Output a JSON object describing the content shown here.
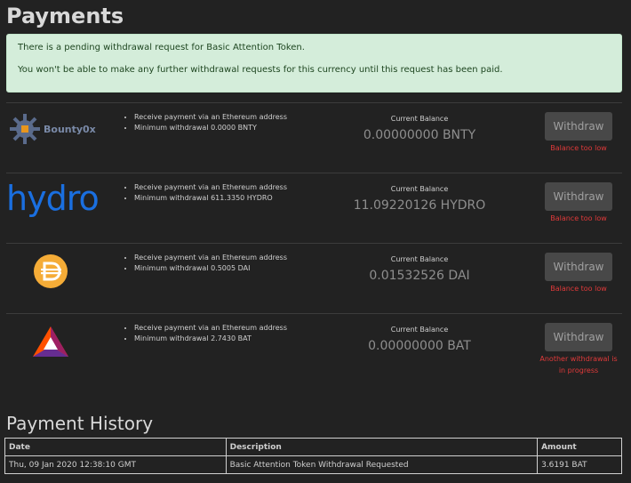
{
  "page": {
    "title": "Payments"
  },
  "alert": {
    "line1": "There is a pending withdrawal request for Basic Attention Token.",
    "line2": "You won't be able to make any further withdrawal requests for this currency until this request has been paid."
  },
  "currencies": [
    {
      "logo": "bountyox-logo",
      "logo_text": "Bounty0x",
      "features": [
        "Receive payment via an Ethereum address",
        "Minimum withdrawal 0.0000 BNTY"
      ],
      "balance_label": "Current Balance",
      "balance": "0.00000000 BNTY",
      "button_label": "Withdraw",
      "status": "Balance too low"
    },
    {
      "logo": "hydro-logo",
      "logo_text": "hydro",
      "features": [
        "Receive payment via an Ethereum address",
        "Minimum withdrawal 611.3350 HYDRO"
      ],
      "balance_label": "Current Balance",
      "balance": "11.09220126 HYDRO",
      "button_label": "Withdraw",
      "status": "Balance too low"
    },
    {
      "logo": "dai-logo",
      "features": [
        "Receive payment via an Ethereum address",
        "Minimum withdrawal 0.5005 DAI"
      ],
      "balance_label": "Current Balance",
      "balance": "0.01532526 DAI",
      "button_label": "Withdraw",
      "status": "Balance too low"
    },
    {
      "logo": "bat-logo",
      "features": [
        "Receive payment via an Ethereum address",
        "Minimum withdrawal 2.7430 BAT"
      ],
      "balance_label": "Current Balance",
      "balance": "0.00000000 BAT",
      "button_label": "Withdraw",
      "status": "Another withdrawal is in progress"
    }
  ],
  "history": {
    "title": "Payment History",
    "headers": [
      "Date",
      "Description",
      "Amount"
    ],
    "rows": [
      [
        "Thu, 09 Jan 2020 12:38:10 GMT",
        "Basic Attention Token Withdrawal Requested",
        "3.6191 BAT"
      ]
    ]
  },
  "colors": {
    "background": "#222222",
    "alert_bg": "#d4edda",
    "alert_text": "#1e4620",
    "button_bg": "#484848",
    "status_red": "#e03a3a",
    "hydro_blue": "#1a6fe0",
    "dai_orange": "#f5ac37",
    "bat_orange": "#ff5000",
    "bat_purple": "#9e1f63"
  }
}
